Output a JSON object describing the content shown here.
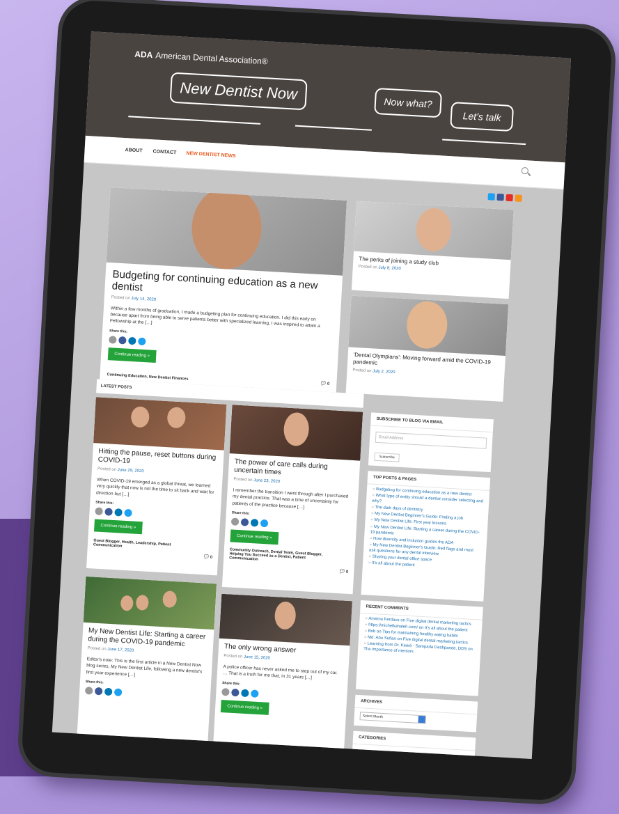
{
  "header": {
    "ada_abbr": "ADA",
    "ada_name": "American Dental Association®",
    "bubble_main": "New Dentist Now",
    "bubble_2": "Now what?",
    "bubble_3": "Let's talk"
  },
  "nav": {
    "items": [
      {
        "label": "ABOUT"
      },
      {
        "label": "CONTACT"
      },
      {
        "label": "NEW DENTIST NEWS"
      }
    ]
  },
  "featured": {
    "title": "Budgeting for continuing education as a new dentist",
    "posted_prefix": "Posted on",
    "date": "July 14, 2020",
    "excerpt": "Within a few months of graduation, I made a budgeting plan for continuing education. I did this early on because apart from being able to serve patients better with specialized learning, I was inspired to attain a Fellowship at the […]",
    "share": "Share this:",
    "button": "Continue reading »",
    "cats": "Continuing Education, New Dentist Finances",
    "comments": "0"
  },
  "side_posts": [
    {
      "title": "The perks of joining a study club",
      "posted_prefix": "Posted on",
      "date": "July 8, 2020"
    },
    {
      "title": "'Dental Olympians': Moving forward amid the COVID-19 pandemic",
      "posted_prefix": "Posted on",
      "date": "July 2, 2020"
    }
  ],
  "latest_label": "LATEST POSTS",
  "posts": [
    {
      "title": "Hitting the pause, reset buttons during COVID-19",
      "posted_prefix": "Posted on",
      "date": "June 29, 2020",
      "excerpt": "When COVID-19 emerged as a global threat, we learned very quickly that now is not the time to sit back and wait for direction but […]",
      "share": "Share this:",
      "button": "Continue reading »",
      "cats": "Guest Blogger, Health, Leadership, Patient Communication",
      "comments": "0"
    },
    {
      "title": "The power of care calls during uncertain times",
      "posted_prefix": "Posted on",
      "date": "June 23, 2020",
      "excerpt": "I remember the transition I went through after I purchased my dental practice. That was a time of uncertainty for patients of the practice because […]",
      "share": "Share this:",
      "button": "Continue reading »",
      "cats": "Community Outreach, Dental Team, Guest Blogger, Helping You Succeed as a Dentist, Patient Communication",
      "comments": "0"
    },
    {
      "title": "My New Dentist Life: Starting a career during the COVID-19 pandemic",
      "posted_prefix": "Posted on",
      "date": "June 17, 2020",
      "excerpt": "Editor's note: This is the first article in a New Dentist Now blog series, My New Dentist Life, following a new dentist's first year experience […]",
      "share": "Share this:"
    },
    {
      "title": "The only wrong answer",
      "posted_prefix": "Posted on",
      "date": "June 15, 2020",
      "excerpt": "A police officer has never asked me to step out of my car. … That is a truth for me that, in 31 years […]",
      "share": "Share this:",
      "button": "Continue reading »"
    }
  ],
  "subscribe": {
    "title": "SUBSCRIBE TO BLOG VIA EMAIL",
    "placeholder": "Email Address",
    "button": "Subscribe"
  },
  "top_posts": {
    "title": "TOP POSTS & PAGES",
    "items": [
      "Budgeting for continuing education as a new dentist",
      "What type of entity should a dentist consider selecting and why?",
      "The dark days of dentistry",
      "My New Dentist Beginner's Guide: Finding a job",
      "My New Dentist Life: First year lessons",
      "My New Dentist Life: Starting a career during the COVID-19 pandemic",
      "How diversity and inclusion guides the ADA",
      "My New Dentist Beginner's Guide: Red flags and must ask questions for any dental interview",
      "Sharing your dental office space",
      "It's all about the patient"
    ]
  },
  "recent_comments": {
    "title": "RECENT COMMENTS",
    "items": [
      "Anonna Ferdaus on Five digital dental marketing tactics",
      "https://michelkahaleh.com/ on It's all about the patient",
      "Bob on Tips for maintaining healthy eating habits",
      "Md. Abu Sufian on Five digital dental marketing tactics",
      "Learning from Dr. Keerti - Sampada Deshpande, DDS on The importance of mentors"
    ]
  },
  "archives": {
    "title": "ARCHIVES",
    "select": "Select Month"
  },
  "categories": {
    "title": "CATEGORIES"
  },
  "colors": {
    "header_bg": "#4a4440",
    "accent_orange": "#e8581c",
    "button_green": "#23a339",
    "link_blue": "#1a6fb0"
  }
}
